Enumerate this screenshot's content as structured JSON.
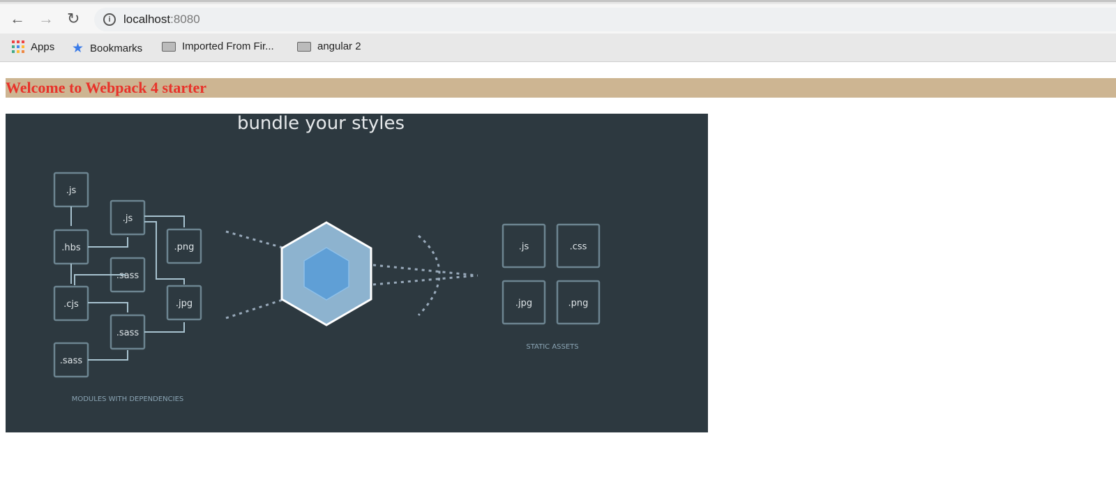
{
  "browser": {
    "url_host": "localhost",
    "url_port": ":8080",
    "bookmarks": [
      {
        "label": "Apps",
        "icon": "apps-icon"
      },
      {
        "label": "Bookmarks",
        "icon": "star-icon"
      },
      {
        "label": "Imported From Fir...",
        "icon": "folder-icon"
      },
      {
        "label": "angular 2",
        "icon": "folder-icon"
      }
    ]
  },
  "page": {
    "heading": "Welcome to Webpack 4 starter",
    "heading_color": "#e8322a",
    "heading_bg": "#cdb592"
  },
  "hero": {
    "title": "bundle your styles",
    "modules": [
      ".js",
      ".js",
      ".hbs",
      ".png",
      ".sass",
      ".cjs",
      ".jpg",
      ".sass",
      ".sass"
    ],
    "modules_caption": "MODULES WITH DEPENDENCIES",
    "assets": [
      ".js",
      ".css",
      ".jpg",
      ".png"
    ],
    "assets_caption": "STATIC ASSETS"
  }
}
